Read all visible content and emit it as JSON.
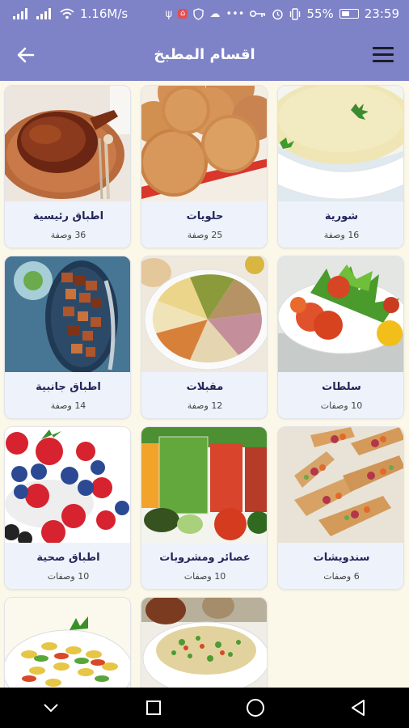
{
  "status_bar": {
    "network_speed": "1.16M/s",
    "battery": "55%",
    "time": "23:59",
    "icons": [
      "signal-icon",
      "signal-4g-icon",
      "wifi-icon",
      "usb-icon",
      "notification-icon",
      "shield-icon",
      "cloud-icon",
      "more-icon",
      "key-icon",
      "alarm-icon",
      "vibrate-icon",
      "battery-icon"
    ]
  },
  "app_bar": {
    "title": "اقسام المطبخ",
    "back_icon": "arrow-left-icon",
    "menu_icon": "hamburger-menu-icon"
  },
  "categories": [
    {
      "name": "شورية",
      "count": "16 وصفة",
      "image": "soup"
    },
    {
      "name": "حلويات",
      "count": "25 وصفة",
      "image": "cookies"
    },
    {
      "name": "اطباق رئيسية",
      "count": "36 وصفة",
      "image": "roast"
    },
    {
      "name": "سلطات",
      "count": "10 وصفات",
      "image": "salad"
    },
    {
      "name": "مقبلات",
      "count": "12 وصفة",
      "image": "appetizers"
    },
    {
      "name": "اطباق جانبية",
      "count": "14 وصفة",
      "image": "potatoes"
    },
    {
      "name": "سندويشات",
      "count": "6 وصفات",
      "image": "sandwiches"
    },
    {
      "name": "عصائر ومشروبات",
      "count": "10 وصفات",
      "image": "juices"
    },
    {
      "name": "اطباق صحية",
      "count": "10 وصفات",
      "image": "berries"
    },
    {
      "name": "",
      "count": "",
      "image": "quinoa"
    },
    {
      "name": "",
      "count": "",
      "image": "pasta"
    }
  ],
  "nav_bar": {
    "icons": [
      "nav-collapse-icon",
      "nav-recents-icon",
      "nav-home-icon",
      "nav-back-icon"
    ]
  }
}
